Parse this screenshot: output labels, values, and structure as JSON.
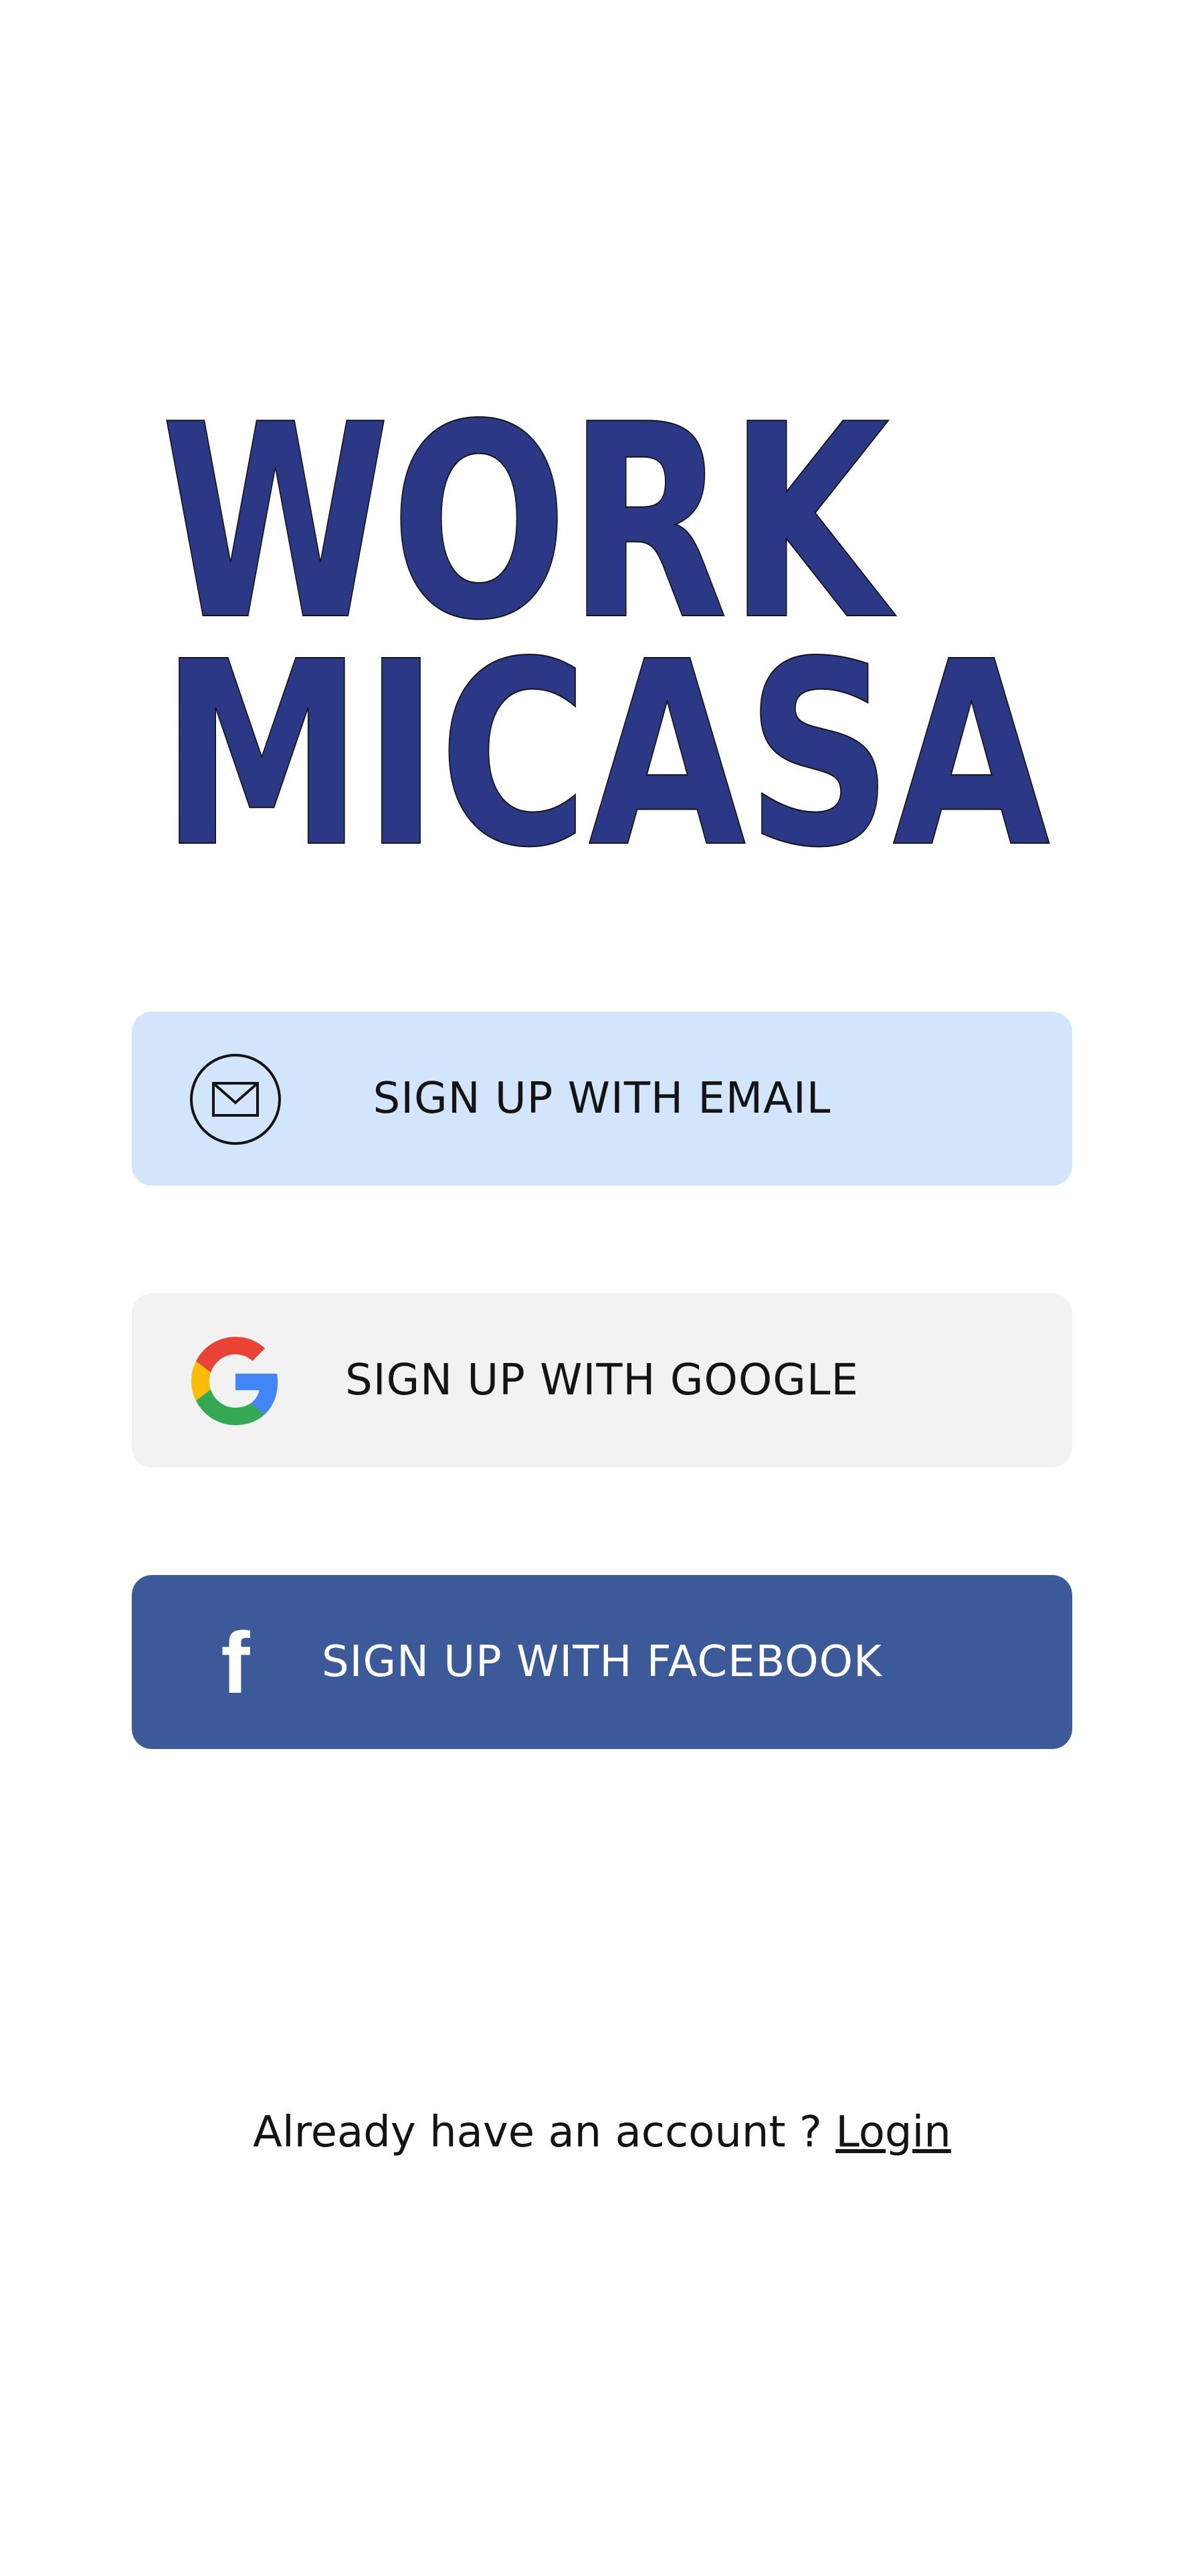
{
  "logo": {
    "line1": "WORK",
    "line2": "MICASA",
    "color": "#2b3886"
  },
  "buttons": {
    "email": {
      "label": "SIGN UP WITH EMAIL",
      "icon": "envelope-icon",
      "bg": "#d2e5fb"
    },
    "google": {
      "label": "SIGN UP WITH GOOGLE",
      "icon": "google-icon",
      "bg": "#f2f2f2"
    },
    "facebook": {
      "label": "SIGN UP WITH FACEBOOK",
      "icon": "facebook-icon",
      "glyph": "f",
      "bg": "#3c5a99"
    }
  },
  "footer": {
    "prompt": "Already have an account ? ",
    "login_label": "Login"
  }
}
